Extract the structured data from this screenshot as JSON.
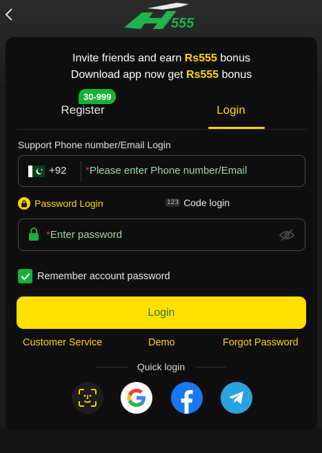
{
  "header": {
    "back_icon": "chevron-left-icon",
    "logo_text": "555"
  },
  "promo": {
    "line1_prefix": "Invite friends and earn ",
    "line1_amount": "Rs555",
    "line1_suffix": " bonus",
    "line2_prefix": "Download app now get ",
    "line2_amount": "Rs555",
    "line2_suffix": " bonus"
  },
  "tabs": {
    "register_label": "Register",
    "register_badge": "30-999",
    "login_label": "Login",
    "active": "Login"
  },
  "form": {
    "support_label": "Support Phone number/Email Login",
    "country_code": "+92",
    "phone_placeholder": "Please enter Phone number/Email",
    "password_login_label": "Password Login",
    "code_login_label": "Code login",
    "code_icon_text": "123",
    "password_placeholder": "Enter password",
    "remember_label": "Remember account password",
    "remember_checked": true,
    "login_button": "Login"
  },
  "links": {
    "customer_service": "Customer Service",
    "demo": "Demo",
    "forgot_password": "Forgot Password"
  },
  "quick_login": {
    "label": "Quick login",
    "providers": [
      "face-id",
      "google",
      "facebook",
      "telegram"
    ]
  },
  "colors": {
    "accent_yellow": "#ffd400",
    "button_yellow": "#ffe000",
    "green": "#19b039",
    "facebook": "#1877f2",
    "telegram": "#2aa3df"
  }
}
